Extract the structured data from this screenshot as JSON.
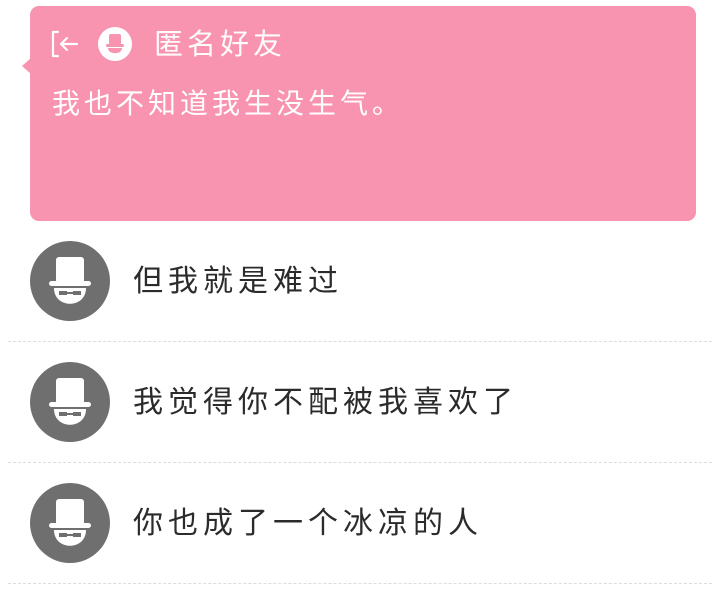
{
  "notification": {
    "back_icon": "back-arrow-icon",
    "avatar_icon": "anonymous-mask-icon",
    "sender": "匿名好友",
    "message": "我也不知道我生没生气。",
    "background_color": "#f893b0",
    "text_color": "#ffffff"
  },
  "messages": [
    {
      "avatar_icon": "anonymous-mask-icon",
      "text": "但我就是难过"
    },
    {
      "avatar_icon": "anonymous-mask-icon",
      "text": "我觉得你不配被我喜欢了"
    },
    {
      "avatar_icon": "anonymous-mask-icon",
      "text": "你也成了一个冰凉的人"
    }
  ],
  "colors": {
    "avatar_gray": "#6f6f6f",
    "text_dark": "#2b2b2b",
    "divider": "#dcdcdc"
  }
}
